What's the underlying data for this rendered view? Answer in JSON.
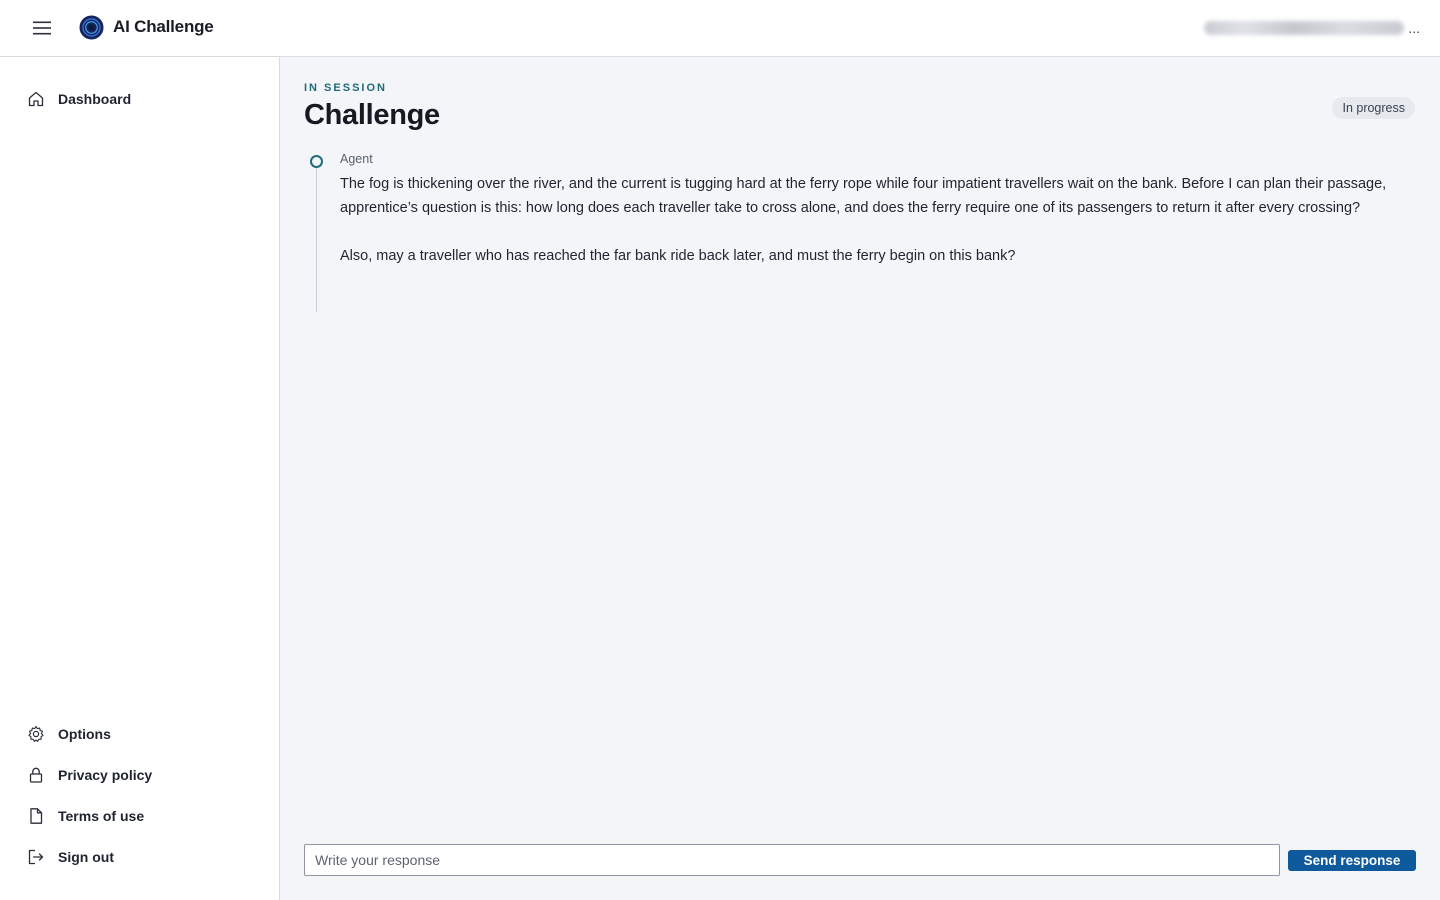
{
  "app": {
    "title": "AI Challenge",
    "user_ellipsis": "..."
  },
  "sidebar": {
    "top_items": [
      {
        "label": "Dashboard",
        "icon": "home-icon"
      }
    ],
    "bottom_items": [
      {
        "label": "Options",
        "icon": "gear-icon"
      },
      {
        "label": "Privacy policy",
        "icon": "lock-icon"
      },
      {
        "label": "Terms of use",
        "icon": "document-icon"
      },
      {
        "label": "Sign out",
        "icon": "sign-out-icon"
      }
    ]
  },
  "main": {
    "eyebrow": "IN SESSION",
    "title": "Challenge",
    "status": "In progress",
    "messages": [
      {
        "author": "Agent",
        "paragraphs": [
          "The fog is thickening over the river, and the current is tugging hard at the ferry rope while four impatient travellers wait on the bank. Before I can plan their passage, apprentice’s question is this: how long does each traveller take to cross alone, and does the ferry require one of its passengers to return it after every crossing?",
          "Also, may a traveller who has reached the far bank ride back later, and must the ferry begin on this bank?"
        ]
      }
    ]
  },
  "composer": {
    "placeholder": "Write your response",
    "value": "",
    "send_label": "Send response"
  },
  "colors": {
    "accent": "#1e6b7a",
    "primary_button": "#0f5a9c",
    "main_background": "#f3f5f8"
  }
}
